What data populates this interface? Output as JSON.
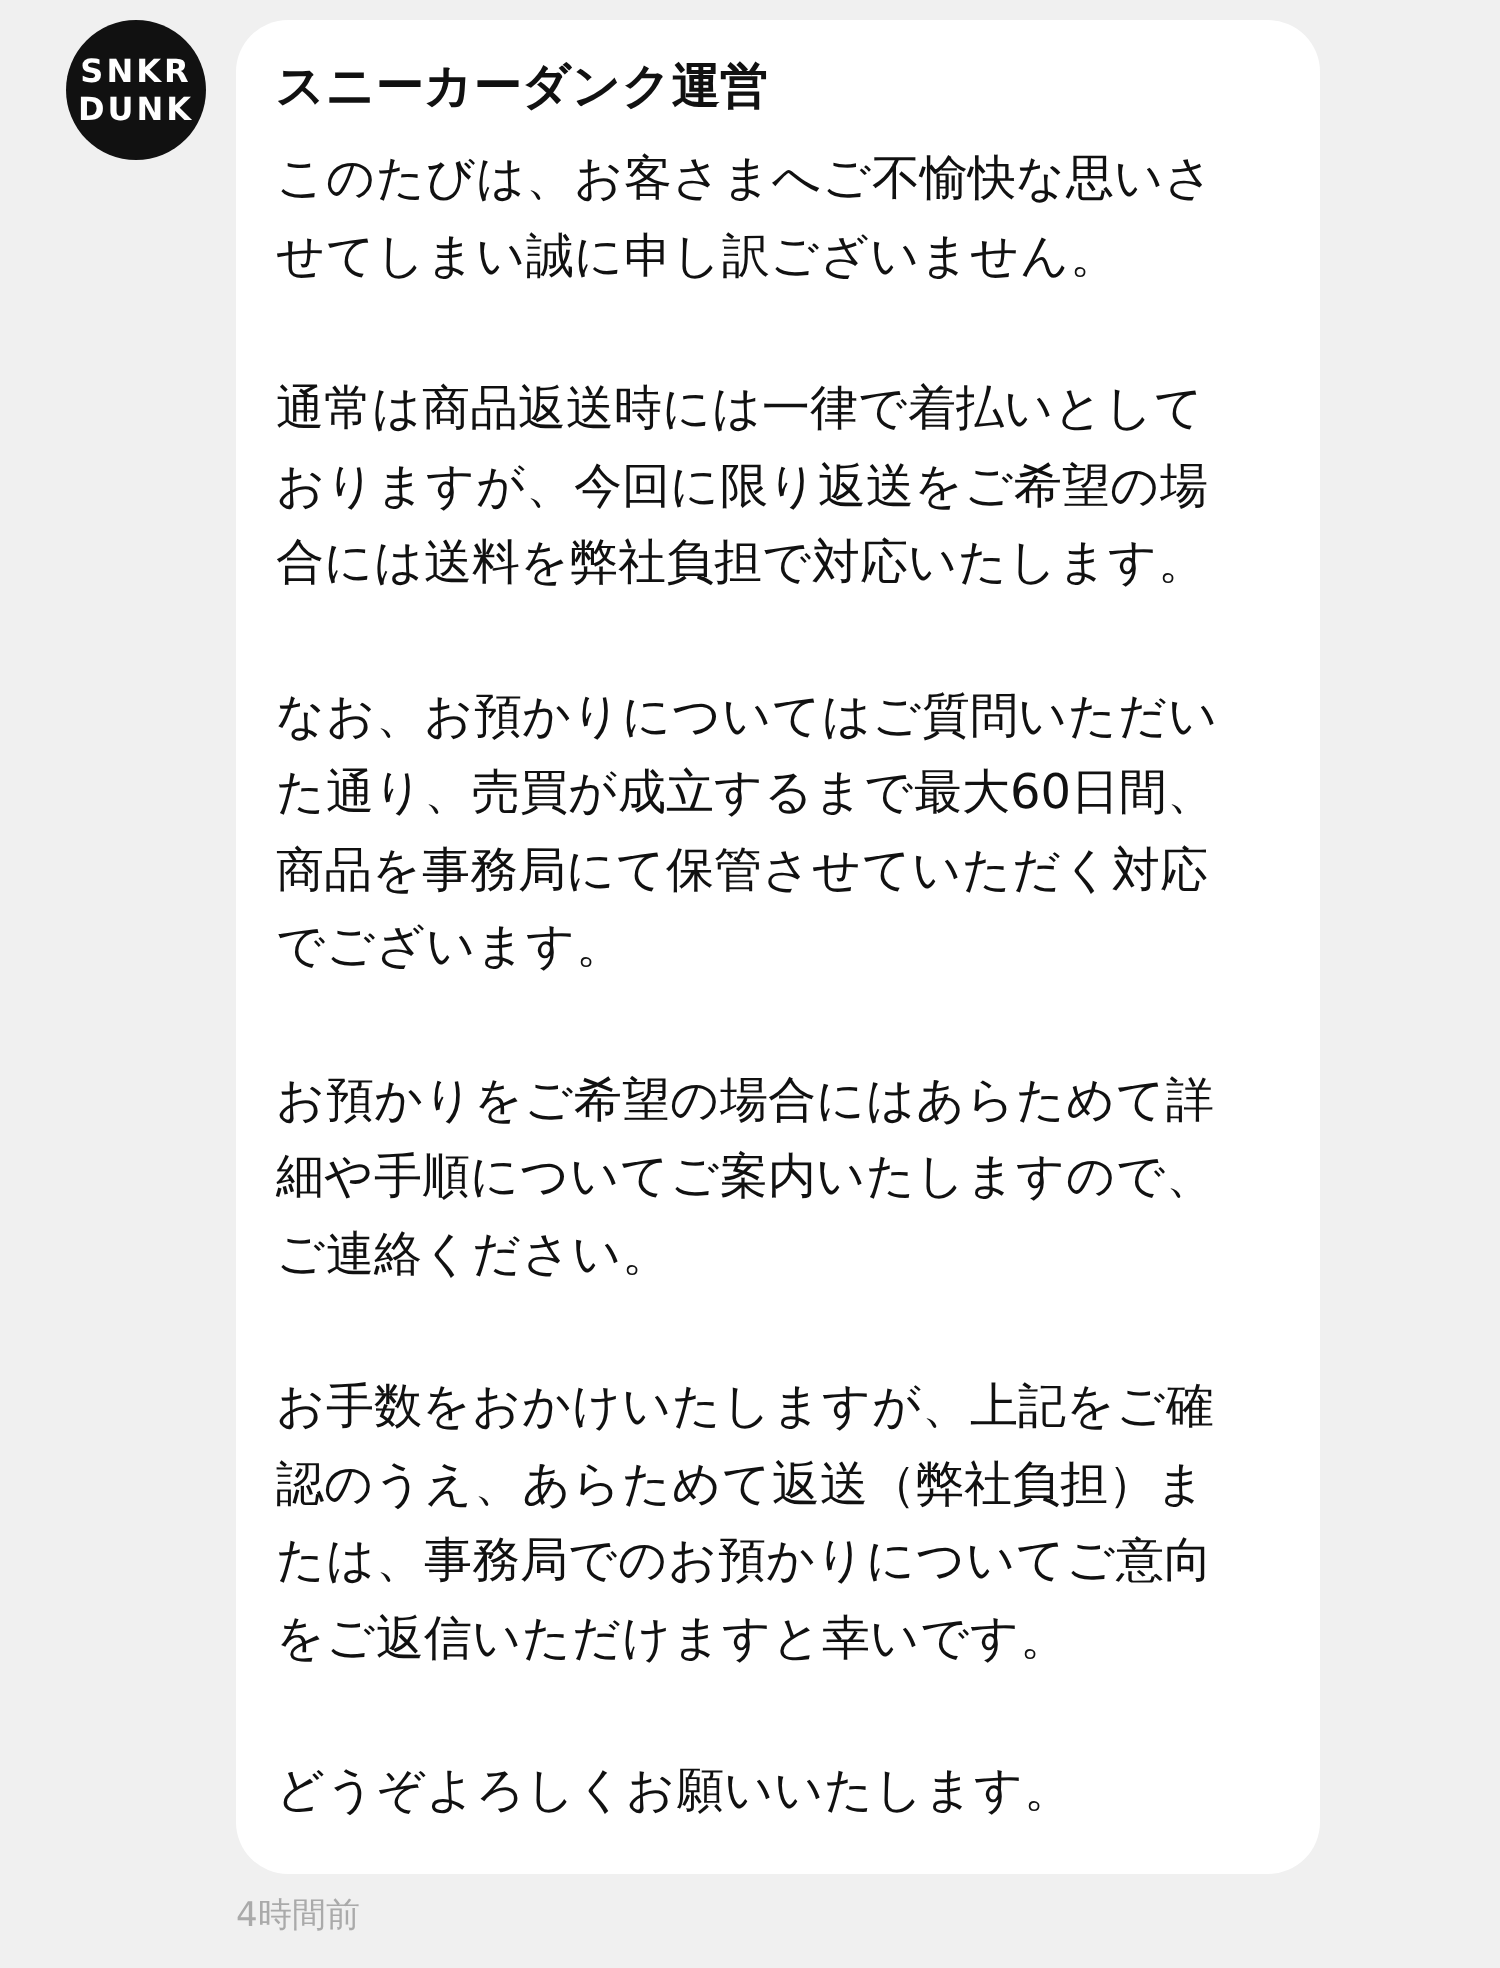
{
  "message": {
    "avatar_text": "SNKR\nDUNK",
    "sender": "スニーカーダンク運営",
    "paragraphs": [
      "このたびは、お客さまへご不愉快な思いさせてしまい誠に申し訳ございません。",
      "通常は商品返送時には一律で着払いとしておりますが、今回に限り返送をご希望の場合には送料を弊社負担で対応いたします。",
      "なお、お預かりについてはご質問いただいた通り、売買が成立するまで最大60日間、商品を事務局にて保管させていただく対応でございます。",
      "お預かりをご希望の場合にはあらためて詳細や手順についてご案内いたしますので、ご連絡ください。",
      "お手数をおかけいたしますが、上記をご確認のうえ、あらためて返送（弊社負担）または、事務局でのお預かりについてご意向をご返信いただけますと幸いです。",
      "どうぞよろしくお願いいたします。"
    ],
    "time": "4時間前"
  }
}
